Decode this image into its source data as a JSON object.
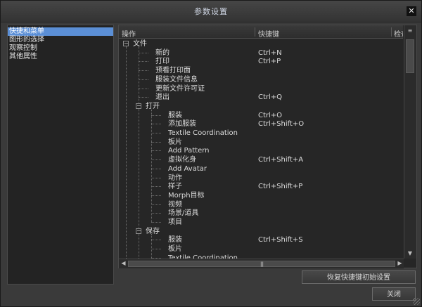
{
  "window": {
    "title": "参数设置",
    "close_glyph": "✕"
  },
  "categories": [
    {
      "label": "快捷和菜单",
      "selected": true
    },
    {
      "label": "图形的选择",
      "selected": false
    },
    {
      "label": "观察控制",
      "selected": false
    },
    {
      "label": "其他属性",
      "selected": false
    }
  ],
  "table": {
    "columns": [
      "操作",
      "快捷键",
      "检查"
    ],
    "rows": [
      {
        "level": 0,
        "expander": "−",
        "action": "文件",
        "shortcut": ""
      },
      {
        "level": 1,
        "action": "新的",
        "shortcut": "Ctrl+N"
      },
      {
        "level": 1,
        "action": "打印",
        "shortcut": "Ctrl+P"
      },
      {
        "level": 1,
        "action": "预看打印面",
        "shortcut": ""
      },
      {
        "level": 1,
        "action": "服装文件信息",
        "shortcut": ""
      },
      {
        "level": 1,
        "action": "更新文件许可证",
        "shortcut": ""
      },
      {
        "level": 1,
        "action": "退出",
        "shortcut": "Ctrl+Q"
      },
      {
        "level": 1,
        "expander": "−",
        "action": "打开",
        "shortcut": ""
      },
      {
        "level": 2,
        "action": "服装",
        "shortcut": "Ctrl+O"
      },
      {
        "level": 2,
        "action": "添加服装",
        "shortcut": "Ctrl+Shift+O"
      },
      {
        "level": 2,
        "action": "Textile Coordination",
        "shortcut": ""
      },
      {
        "level": 2,
        "action": "板片",
        "shortcut": ""
      },
      {
        "level": 2,
        "action": "Add Pattern",
        "shortcut": ""
      },
      {
        "level": 2,
        "action": "虚拟化身",
        "shortcut": "Ctrl+Shift+A"
      },
      {
        "level": 2,
        "action": "Add Avatar",
        "shortcut": ""
      },
      {
        "level": 2,
        "action": "动作",
        "shortcut": ""
      },
      {
        "level": 2,
        "action": "样子",
        "shortcut": "Ctrl+Shift+P"
      },
      {
        "level": 2,
        "action": "Morph目标",
        "shortcut": ""
      },
      {
        "level": 2,
        "action": "视频",
        "shortcut": ""
      },
      {
        "level": 2,
        "action": "场景/道具",
        "shortcut": ""
      },
      {
        "level": 2,
        "action": "项目",
        "shortcut": ""
      },
      {
        "level": 1,
        "expander": "−",
        "action": "保存",
        "shortcut": ""
      },
      {
        "level": 2,
        "action": "服装",
        "shortcut": "Ctrl+Shift+S"
      },
      {
        "level": 2,
        "action": "板片",
        "shortcut": ""
      },
      {
        "level": 2,
        "action": "Textile Coordination",
        "shortcut": ""
      }
    ]
  },
  "scrollbars": {
    "up": "▲",
    "down": "▼",
    "left": "◀",
    "right": "▶",
    "grip": "|||"
  },
  "buttons": {
    "reset": "恢复快捷键初始设置",
    "close": "关闭"
  },
  "icons": {
    "menu": "≡"
  }
}
